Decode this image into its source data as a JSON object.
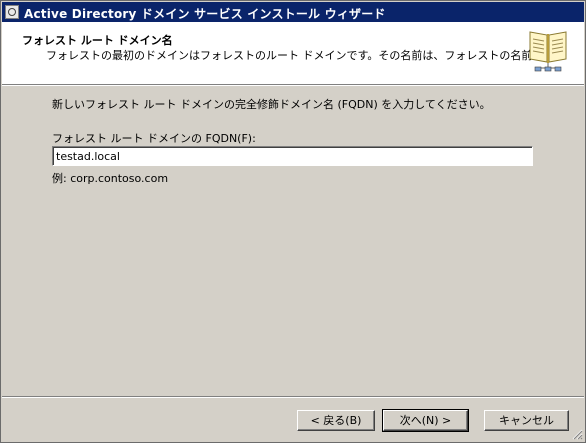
{
  "window": {
    "title": "Active Directory ドメイン サービス インストール ウィザード"
  },
  "header": {
    "title": "フォレスト ルート ドメイン名",
    "subtitle": "フォレストの最初のドメインはフォレストのルート ドメインです。その名前は、フォレストの名前です。",
    "icon": "book-icon"
  },
  "content": {
    "instruction": "新しいフォレスト ルート ドメインの完全修飾ドメイン名 (FQDN) を入力してください。",
    "fqdn_label": "フォレスト ルート ドメインの FQDN(F):",
    "fqdn_value": "testad.local",
    "example": "例: corp.contoso.com"
  },
  "buttons": {
    "back": "< 戻る(B)",
    "next": "次へ(N) >",
    "cancel": "キャンセル"
  }
}
